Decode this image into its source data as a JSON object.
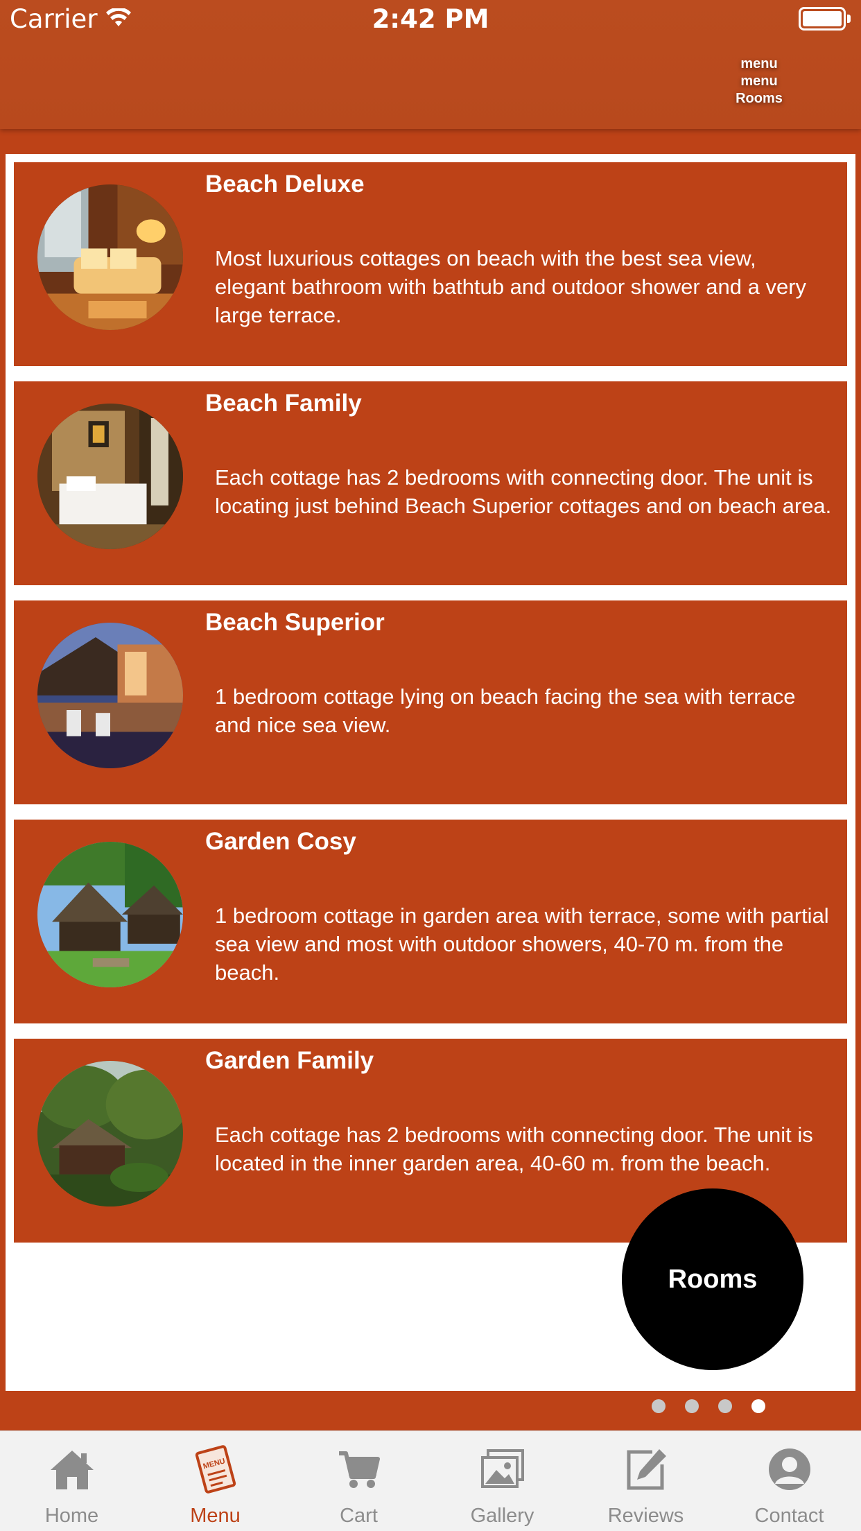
{
  "status_bar": {
    "carrier": "Carrier",
    "time": "2:42 PM"
  },
  "header": {
    "menu_lines": [
      "menu",
      "menu",
      "Rooms"
    ]
  },
  "rooms": [
    {
      "title": "Beach Deluxe",
      "description": "Most luxurious cottages on beach with the best sea view, elegant bathroom with bathtub and outdoor shower and a very large terrace.",
      "image": "interior-lounge-photo"
    },
    {
      "title": "Beach Family",
      "description": "Each cottage has 2 bedrooms with connecting door. The unit is locating just behind Beach Superior cottages and on beach area.",
      "image": "bedroom-photo"
    },
    {
      "title": "Beach Superior",
      "description": "1 bedroom cottage lying on beach facing the sea with terrace and nice sea view.",
      "image": "terrace-sea-photo"
    },
    {
      "title": "Garden Cosy",
      "description": "1 bedroom cottage in garden area with terrace, some with partial sea view and most with outdoor showers, 40-70 m. from the beach.",
      "image": "garden-hut-photo"
    },
    {
      "title": "Garden Family",
      "description": "Each cottage has 2 bedrooms with connecting door. The unit is located in the inner garden area, 40-60 m. from the beach.",
      "image": "garden-trees-photo"
    }
  ],
  "fab": {
    "label": "Rooms"
  },
  "pager": {
    "count": 4,
    "active_index": 3
  },
  "tabs": [
    {
      "label": "Home",
      "icon": "home-icon",
      "active": false
    },
    {
      "label": "Menu",
      "icon": "menu-book-icon",
      "active": true
    },
    {
      "label": "Cart",
      "icon": "cart-icon",
      "active": false
    },
    {
      "label": "Gallery",
      "icon": "gallery-icon",
      "active": false
    },
    {
      "label": "Reviews",
      "icon": "edit-icon",
      "active": false
    },
    {
      "label": "Contact",
      "icon": "user-icon",
      "active": false
    }
  ],
  "colors": {
    "brand": "#bd4217",
    "tab_inactive": "#8c8c8c",
    "tab_bar": "#f2f2f2"
  }
}
